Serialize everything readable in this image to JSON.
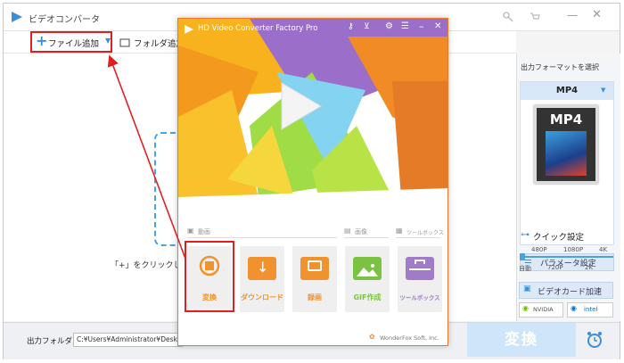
{
  "main_window": {
    "title": "ビデオコンバータ",
    "toolbar": {
      "add_file_label": "ファイル追加",
      "add_folder_label": "フォルダ追加"
    },
    "hint_text": "「+」をクリックして",
    "output_folder_label": "出力フォルダ：",
    "output_folder_path": "C:¥Users¥Administrator¥Desktop",
    "convert_button_label": "変換"
  },
  "right_panel": {
    "select_format_label": "出力フォーマットを選択",
    "format_name": "MP4",
    "format_badge": "MP4",
    "parameter_button_label": "パラメータ設定",
    "quick_settings_label": "クイック設定",
    "quality_top": [
      "480P",
      "1080P",
      "4K"
    ],
    "quality_bottom": [
      "自動",
      "720P",
      "2K"
    ],
    "gpu_accel_label": "ビデオカード加速",
    "nvidia_label": "NVIDIA",
    "intel_label": "intel"
  },
  "foreground_window": {
    "title": "HD Video Converter Factory Pro",
    "section_video": "動画",
    "section_image": "画像",
    "section_toolbox": "ツールボックス",
    "tools": [
      {
        "label": "変換",
        "color": "#f0922e"
      },
      {
        "label": "ダウンロード",
        "color": "#f0922e"
      },
      {
        "label": "録画",
        "color": "#f0922e"
      },
      {
        "label": "GIF作成",
        "color": "#7cc242"
      },
      {
        "label": "ツールボックス",
        "color": "#a07cc8"
      }
    ],
    "footer": "WonderFox Soft, Inc."
  },
  "colors": {
    "accent_blue": "#4aa3df",
    "highlight_red": "#e02020",
    "brand_orange": "#f0922e"
  }
}
